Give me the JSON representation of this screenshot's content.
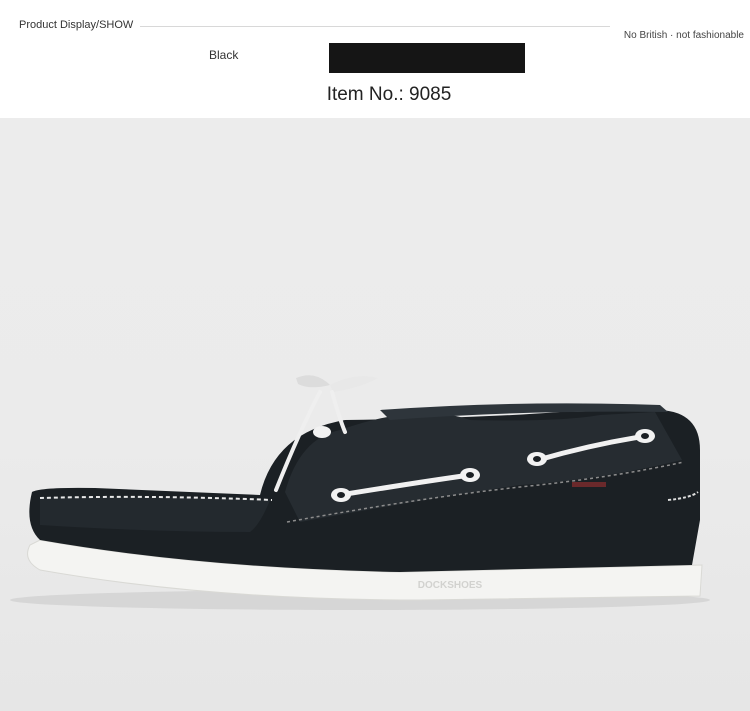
{
  "header": {
    "section_title": "Product Display/SHOW",
    "tagline": "No British · not fashionable",
    "color_label": "Black",
    "swatch_color": "#151515",
    "item_number": "Item No.: 9085"
  },
  "product": {
    "image": "black-leather-boat-shoe",
    "sole_emboss": "DOCKSHOES"
  }
}
